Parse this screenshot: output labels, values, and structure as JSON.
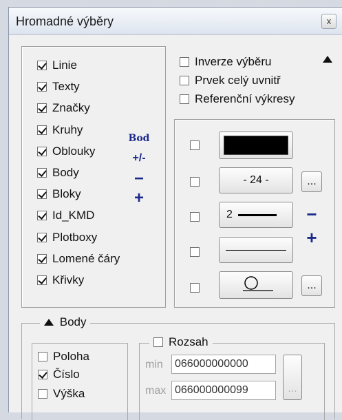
{
  "window": {
    "title": "Hromadné výběry",
    "close_label": "x"
  },
  "layers": [
    {
      "label": "Linie",
      "checked": true
    },
    {
      "label": "Texty",
      "checked": true
    },
    {
      "label": "Značky",
      "checked": true
    },
    {
      "label": "Kruhy",
      "checked": true
    },
    {
      "label": "Oblouky",
      "checked": true
    },
    {
      "label": "Body",
      "checked": true
    },
    {
      "label": "Bloky",
      "checked": true
    },
    {
      "label": "Id_KMD",
      "checked": true
    },
    {
      "label": "Plotboxy",
      "checked": true
    },
    {
      "label": "Lomené čáry",
      "checked": true
    },
    {
      "label": "Křivky",
      "checked": true
    }
  ],
  "side_ops": {
    "bod": "Bod",
    "toggle": "+/-",
    "minus": "−",
    "plus": "+"
  },
  "options": [
    {
      "label": "Inverze výběru",
      "checked": false
    },
    {
      "label": "Prvek celý uvnitř",
      "checked": false
    },
    {
      "label": "Referenční výkresy",
      "checked": false
    }
  ],
  "style_filters": {
    "weight_value": "- 24 -",
    "line_width_value": "2",
    "more_label": "...",
    "minus": "−",
    "plus": "+"
  },
  "body_section": {
    "title": "Body",
    "poloha": {
      "label": "Poloha",
      "checked": false
    },
    "cislo": {
      "label": "Číslo",
      "checked": true
    },
    "vyska": {
      "label": "Výška",
      "checked": false
    },
    "range": {
      "label": "Rozsah",
      "checked": false,
      "min_label": "min",
      "min_value": "066000000000",
      "max_label": "max",
      "max_value": "066000000099",
      "more_label": "..."
    }
  }
}
